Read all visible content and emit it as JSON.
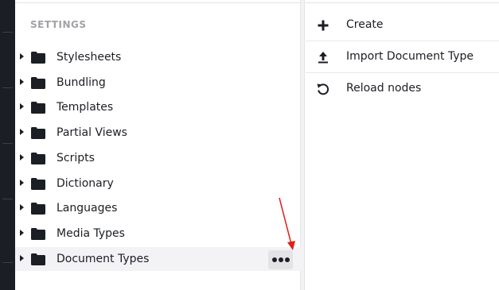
{
  "tree": {
    "section_title": "SETTINGS",
    "items": [
      {
        "label": "Stylesheets"
      },
      {
        "label": "Bundling"
      },
      {
        "label": "Templates"
      },
      {
        "label": "Partial Views"
      },
      {
        "label": "Scripts"
      },
      {
        "label": "Dictionary"
      },
      {
        "label": "Languages"
      },
      {
        "label": "Media Types"
      },
      {
        "label": "Document Types",
        "active": true
      }
    ],
    "more_button_icon": "ellipsis-icon"
  },
  "actions_menu": {
    "items": [
      {
        "label": "Create",
        "icon": "plus-icon"
      },
      {
        "label": "Import Document Type",
        "icon": "upload-icon"
      },
      {
        "label": "Reload nodes",
        "icon": "reload-icon"
      }
    ]
  },
  "colors": {
    "annotation_arrow": "#e0201a",
    "text": "#1b1e24",
    "section_title": "#a2a1a6",
    "active_row": "#f3f3f5",
    "left_bar": "#1b1e24"
  }
}
